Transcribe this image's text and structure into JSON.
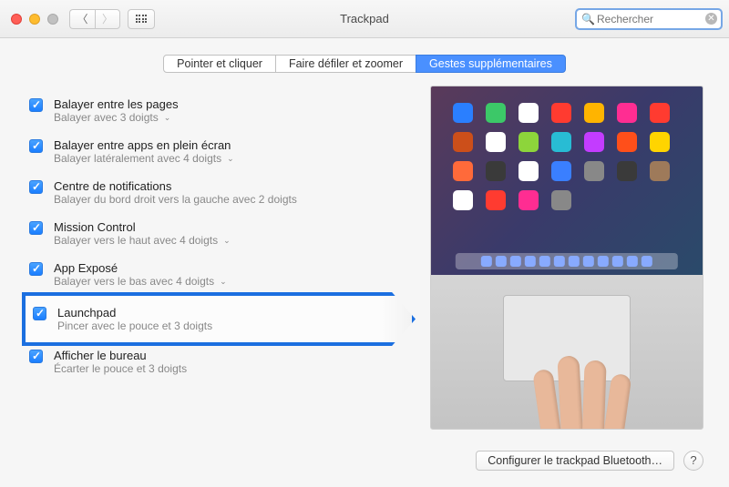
{
  "window": {
    "title": "Trackpad",
    "search_placeholder": "Rechercher"
  },
  "tabs": [
    {
      "label": "Pointer et cliquer",
      "active": false
    },
    {
      "label": "Faire défiler et zoomer",
      "active": false
    },
    {
      "label": "Gestes supplémentaires",
      "active": true
    }
  ],
  "options": [
    {
      "title": "Balayer entre les pages",
      "subtitle": "Balayer avec 3 doigts",
      "dropdown": true,
      "checked": true,
      "selected": false
    },
    {
      "title": "Balayer entre apps en plein écran",
      "subtitle": "Balayer latéralement avec 4 doigts",
      "dropdown": true,
      "checked": true,
      "selected": false
    },
    {
      "title": "Centre de notifications",
      "subtitle": "Balayer du bord droit vers la gauche avec 2 doigts",
      "dropdown": false,
      "checked": true,
      "selected": false
    },
    {
      "title": "Mission Control",
      "subtitle": "Balayer vers le haut avec 4 doigts",
      "dropdown": true,
      "checked": true,
      "selected": false
    },
    {
      "title": "App Exposé",
      "subtitle": "Balayer vers le bas avec 4 doigts",
      "dropdown": true,
      "checked": true,
      "selected": false
    },
    {
      "title": "Launchpad",
      "subtitle": "Pincer avec le pouce et 3 doigts",
      "dropdown": false,
      "checked": true,
      "selected": true
    },
    {
      "title": "Afficher le bureau",
      "subtitle": "Écarter le pouce et 3 doigts",
      "dropdown": false,
      "checked": true,
      "selected": false
    }
  ],
  "footer": {
    "bluetooth_button": "Configurer le trackpad Bluetooth…",
    "help": "?"
  },
  "preview_app_colors": [
    "#2a7fff",
    "#3cc868",
    "#ffffff",
    "#ff3b30",
    "#ffb400",
    "#ff2d92",
    "#ff3b30",
    "#cc4f1a",
    "#ffffff",
    "#8dd53b",
    "#28bcd4",
    "#c33cff",
    "#ff4f1a",
    "#ffd400",
    "#ff6a3a",
    "#3a3a3a",
    "#ffffff",
    "#3a7fff",
    "#888888",
    "#3a3a3a",
    "#9e7a5a",
    "#ffffff",
    "#ff3b30",
    "#ff2d92",
    "#888888"
  ]
}
